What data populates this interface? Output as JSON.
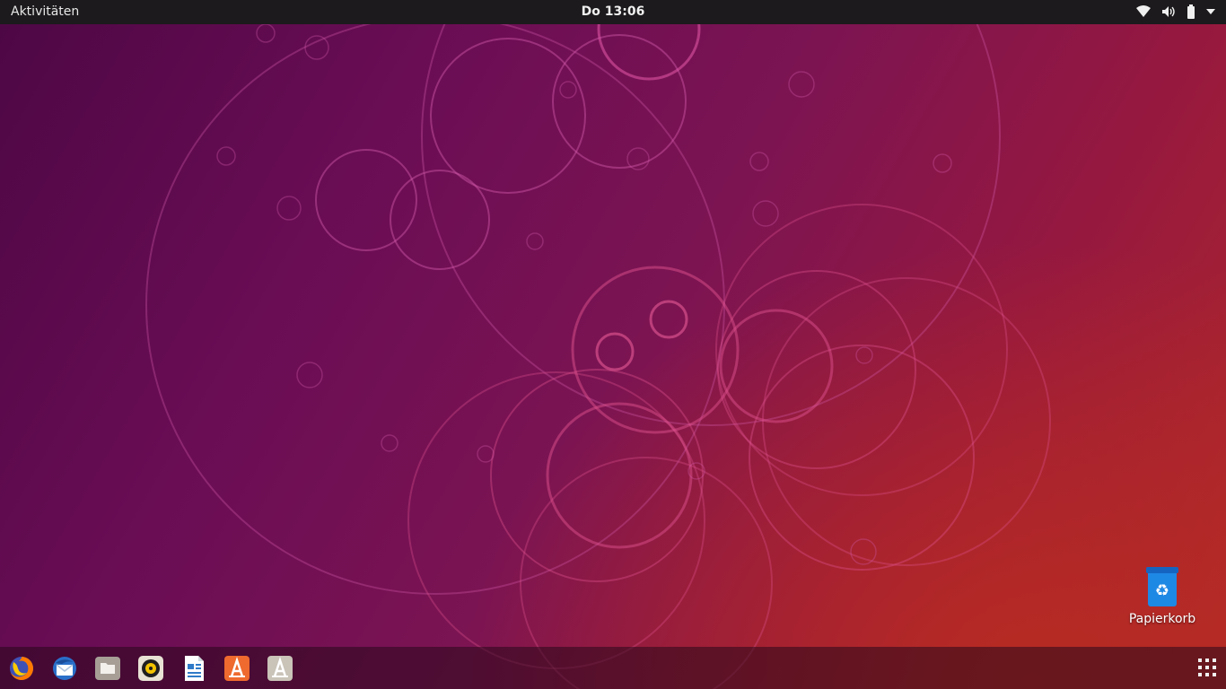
{
  "topbar": {
    "activities_label": "Aktivitäten",
    "clock": "Do 13:06",
    "tray_icons": [
      "wifi-icon",
      "volume-icon",
      "battery-icon",
      "system-menu-arrow-icon"
    ]
  },
  "desktop": {
    "trash_label": "Papierkorb",
    "trash_icon": "trash-icon"
  },
  "dock": {
    "items": [
      {
        "name": "firefox",
        "icon": "firefox-icon"
      },
      {
        "name": "thunderbird",
        "icon": "thunderbird-icon"
      },
      {
        "name": "files",
        "icon": "files-icon"
      },
      {
        "name": "rhythmbox",
        "icon": "rhythmbox-icon"
      },
      {
        "name": "libreoffice-writer",
        "icon": "writer-icon"
      },
      {
        "name": "ubuntu-software",
        "icon": "software-icon"
      },
      {
        "name": "help",
        "icon": "help-icon"
      }
    ],
    "show_apps_icon": "show-applications-icon"
  },
  "colors": {
    "topbar": "#1c1a1c",
    "accent_orange": "#e95420",
    "trash_blue": "#1e88e5"
  }
}
